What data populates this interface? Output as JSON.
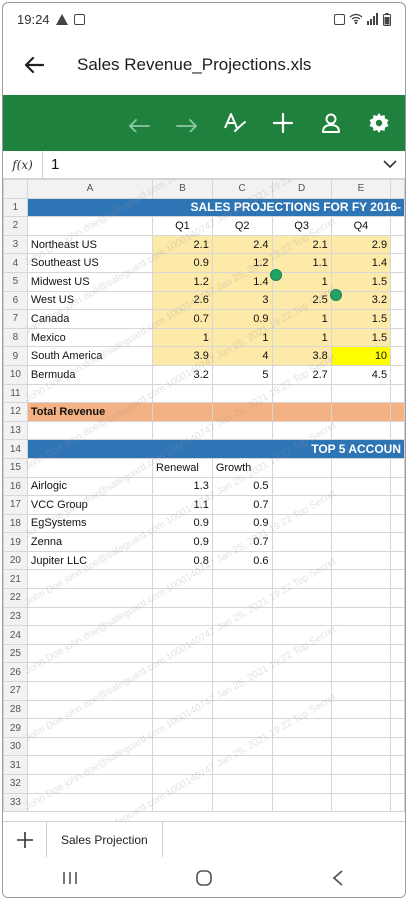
{
  "status": {
    "time": "19:24"
  },
  "title": "Sales Revenue_Projections.xls",
  "formula": {
    "fx_label": "f(x)",
    "value": "1"
  },
  "columns": [
    "A",
    "B",
    "C",
    "D",
    "E"
  ],
  "sheet_title": "SALES PROJECTIONS FOR FY 2016-",
  "quarters": [
    "Q1",
    "Q2",
    "Q3",
    "Q4"
  ],
  "regions": [
    {
      "name": "Northeast US",
      "q": [
        "2.1",
        "2.4",
        "2.1",
        "2.9"
      ]
    },
    {
      "name": "Southeast US",
      "q": [
        "0.9",
        "1.2",
        "1.1",
        "1.4"
      ]
    },
    {
      "name": "Midwest US",
      "q": [
        "1.2",
        "1.4",
        "1",
        "1.5"
      ]
    },
    {
      "name": "West US",
      "q": [
        "2.6",
        "3",
        "2.5",
        "3.2"
      ]
    },
    {
      "name": "Canada",
      "q": [
        "0.7",
        "0.9",
        "1",
        "1.5"
      ]
    },
    {
      "name": "Mexico",
      "q": [
        "1",
        "1",
        "1",
        "1.5"
      ]
    },
    {
      "name": "South America",
      "q": [
        "3.9",
        "4",
        "3.8",
        "10"
      ]
    },
    {
      "name": "Bermuda",
      "q": [
        "3.2",
        "5",
        "2.7",
        "4.5"
      ]
    }
  ],
  "total_label": "Total Revenue",
  "accounts_title": "TOP 5 ACCOUN",
  "account_headers": [
    "Renewal",
    "Growth"
  ],
  "accounts": [
    {
      "name": "Airlogic",
      "renewal": "1.3",
      "growth": "0.5"
    },
    {
      "name": "VCC Group",
      "renewal": "1.1",
      "growth": "0.7"
    },
    {
      "name": "EgSystems",
      "renewal": "0.9",
      "growth": "0.9"
    },
    {
      "name": "Zenna",
      "renewal": "0.9",
      "growth": "0.7"
    },
    {
      "name": "Jupiter LLC",
      "renewal": "0.8",
      "growth": "0.6"
    }
  ],
  "row_numbers": [
    "1",
    "2",
    "3",
    "4",
    "5",
    "6",
    "7",
    "8",
    "9",
    "10",
    "11",
    "12",
    "13",
    "14",
    "15",
    "16",
    "17",
    "18",
    "19",
    "20",
    "21",
    "22",
    "23",
    "24",
    "25",
    "26",
    "27",
    "28",
    "29",
    "30",
    "31",
    "32",
    "33"
  ],
  "watermark_text": "John Doe john.doe@safeguard.com 1000140747 Jan 25, 2021 19:22 Top Secret",
  "sheet_tab": "Sales Projection",
  "colors": {
    "toolbar": "#20813f",
    "title_band": "#2e75b6",
    "data_fill": "#fde9a8",
    "highlight": "#ffff00",
    "total_band": "#f4b183"
  }
}
